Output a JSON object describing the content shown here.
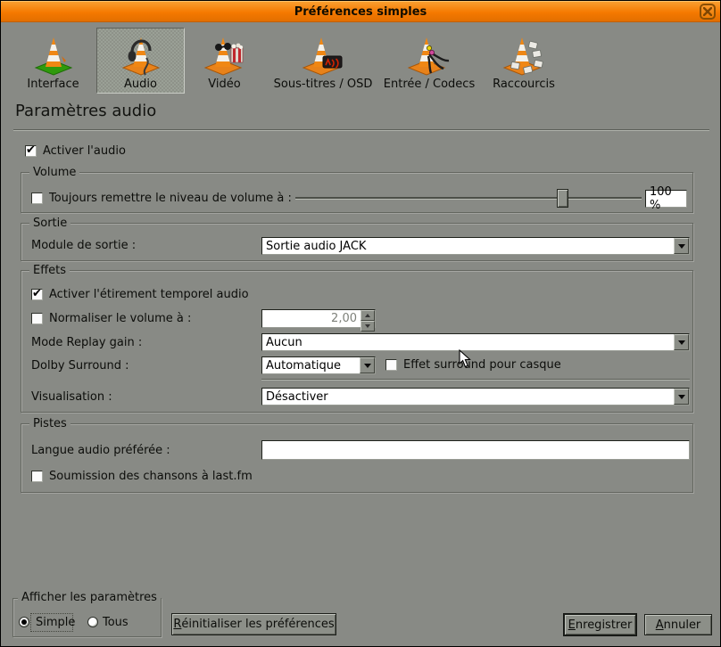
{
  "window": {
    "title": "Préférences simples",
    "close_icon": "close-icon",
    "titlebar_color": "#f57900",
    "background_color": "#888a85"
  },
  "toolbar": {
    "items": [
      {
        "label": "Interface",
        "icon": "vlc-cone-interface-icon",
        "selected": false
      },
      {
        "label": "Audio",
        "icon": "vlc-cone-audio-icon",
        "selected": true
      },
      {
        "label": "Vidéo",
        "icon": "vlc-cone-video-icon",
        "selected": false
      },
      {
        "label": "Sous-titres / OSD",
        "icon": "vlc-cone-subtitles-icon",
        "selected": false
      },
      {
        "label": "Entrée / Codecs",
        "icon": "vlc-cone-input-codecs-icon",
        "selected": false
      },
      {
        "label": "Raccourcis",
        "icon": "vlc-cone-shortcuts-icon",
        "selected": false
      }
    ]
  },
  "page": {
    "heading": "Paramètres audio"
  },
  "enable_audio": {
    "label": "Activer l'audio",
    "checked": true
  },
  "volume_group": {
    "legend": "Volume",
    "always_reset_label": "Toujours remettre le niveau de volume à :",
    "always_reset_checked": false,
    "value": "100 %",
    "slider_percent": 77
  },
  "output_group": {
    "legend": "Sortie",
    "module_label": "Module de sortie :",
    "module_value": "Sortie audio JACK"
  },
  "effects_group": {
    "legend": "Effets",
    "time_stretch_label": "Activer l'étirement temporel audio",
    "time_stretch_checked": true,
    "normalize_label": "Normaliser le volume à :",
    "normalize_checked": false,
    "normalize_value": "2,00",
    "replay_gain_label": "Mode Replay gain :",
    "replay_gain_value": "Aucun",
    "dolby_label": "Dolby Surround :",
    "dolby_value": "Automatique",
    "headphone_label": "Effet surround pour casque",
    "headphone_checked": false,
    "visualization_label": "Visualisation :",
    "visualization_value": "Désactiver"
  },
  "tracks_group": {
    "legend": "Pistes",
    "preferred_language_label": "Langue audio préférée :",
    "preferred_language_value": "",
    "lastfm_label": "Soumission des chansons à last.fm",
    "lastfm_checked": false
  },
  "footer": {
    "show_settings_legend": "Afficher les paramètres",
    "simple_label": "Simple",
    "simple_checked": true,
    "tous_label": "Tous",
    "tous_checked": false,
    "reset_button": "Réinitialiser les préférences",
    "save_button": "Enregistrer",
    "cancel_button": "Annuler"
  }
}
